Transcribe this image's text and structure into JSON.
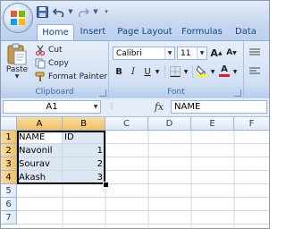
{
  "ribbon_tabs": [
    "Home",
    "Insert",
    "Page Layout",
    "Formulas",
    "Data"
  ],
  "clipboard": {
    "paste_label": "Paste",
    "cut_label": "Cut",
    "copy_label": "Copy",
    "format_painter_label": "Format Painter",
    "group_label": "Clipboard"
  },
  "font": {
    "font_name": "Calibri",
    "font_size": "11",
    "grow_label": "A",
    "shrink_label": "A",
    "bold_label": "B",
    "italic_label": "I",
    "underline_label": "U",
    "font_color_label": "A",
    "group_label": "Font",
    "highlight_color": "#ffff00",
    "font_color": "#e01b1b"
  },
  "formula_bar": {
    "name_box": "A1",
    "fx_label": "fx",
    "formula": "NAME"
  },
  "sheet": {
    "columns": [
      "A",
      "B",
      "C",
      "D",
      "E",
      "F"
    ],
    "row_numbers": [
      "1",
      "2",
      "3",
      "4",
      "5",
      "6",
      "7"
    ],
    "cells": [
      [
        "NAME",
        "ID"
      ],
      [
        "Navonil",
        "1"
      ],
      [
        "Sourav",
        "2"
      ],
      [
        "Akash",
        "3"
      ]
    ]
  }
}
